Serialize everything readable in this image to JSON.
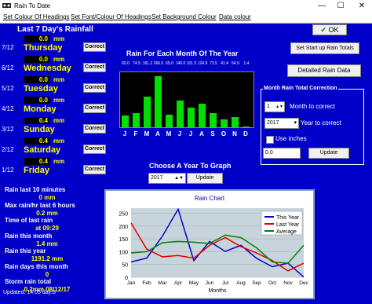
{
  "window": {
    "title": "Rain To Date",
    "min": "—",
    "max": "☐",
    "close": "✕"
  },
  "menu": [
    "Set Colour Of Headings",
    "Set Font/Colour Of Headings",
    "Set Background Colour",
    "Data colour"
  ],
  "ok_label": "OK",
  "heading_7day": "Last 7 Day's Rainfall",
  "days": [
    {
      "date": "7/12",
      "value": "0.0",
      "unit": "mm",
      "name": "Thursday",
      "btn": "Correct"
    },
    {
      "date": "6/12",
      "value": "0.0",
      "unit": "mm",
      "name": "Wednesday",
      "btn": "Correct"
    },
    {
      "date": "5/12",
      "value": "0.0",
      "unit": "mm",
      "name": "Tuesday",
      "btn": "Correct"
    },
    {
      "date": "4/12",
      "value": "0.0",
      "unit": "mm",
      "name": "Monday",
      "btn": "Correct"
    },
    {
      "date": "3/12",
      "value": "0.4",
      "unit": "mm",
      "name": "Sunday",
      "btn": "Correct"
    },
    {
      "date": "2/12",
      "value": "0.4",
      "unit": "mm",
      "name": "Saturday",
      "btn": "Correct"
    },
    {
      "date": "1/12",
      "value": "0.4",
      "unit": "mm",
      "name": "Friday",
      "btn": "Correct"
    }
  ],
  "stats": [
    {
      "label": "Rain last 10 minutes",
      "value": "0 mm"
    },
    {
      "label": "Max rain/hr last 6 hours",
      "value": "0.2 mm"
    },
    {
      "label": "Time of last rain",
      "value": "at 09:29"
    },
    {
      "label": "Rain this month",
      "value": "1.4 mm"
    },
    {
      "label": "Rain this year",
      "value": "1191.2 mm"
    },
    {
      "label": "Rain days this month",
      "value": "0"
    },
    {
      "label": "Storm rain total",
      "value": "0.2mm 08/12/17"
    }
  ],
  "updated": "Updated: 14:05 day:8",
  "monthly": {
    "title": "Rain For Each Month Of The Year",
    "months": [
      "J",
      "F",
      "M",
      "A",
      "M",
      "J",
      "J",
      "A",
      "S",
      "O",
      "N",
      "D"
    ],
    "values": [
      60.0,
      74.5,
      161.2,
      266.0,
      65.0,
      140.0,
      101.5,
      124.9,
      73.5,
      41.4,
      54.9,
      1.4
    ],
    "value_labels": [
      "60.0",
      "74.5",
      "161.2",
      "266.0",
      "65.0",
      "140.0",
      "101.5",
      "124.9",
      "73.5",
      "41.4",
      "54.9",
      "1.4"
    ],
    "max": 280
  },
  "choose_year": {
    "label": "Choose A Year To Graph",
    "value": "2017",
    "btn": "Update"
  },
  "right": {
    "startup_btn": "Set Start up Rain Totals",
    "detailed_btn": "Detailed Rain Data"
  },
  "correction": {
    "title": "Month Rain Total Correction",
    "month_value": "1",
    "month_label": "Month to correct",
    "year_value": "2017",
    "year_label": "Year to correct",
    "use_inches": "Use inches",
    "amount": "0.0",
    "btn": "Update"
  },
  "chart_data": {
    "type": "line",
    "title": "Rain Chart",
    "xlabel": "Months",
    "ylabel": "",
    "categories": [
      "Jan",
      "Feb",
      "Mar",
      "Apr",
      "May",
      "Jun",
      "Jul",
      "Aug",
      "Sep",
      "Oct",
      "Nov",
      "Dec"
    ],
    "yticks": [
      0,
      50,
      100,
      150,
      200,
      250
    ],
    "ylim": [
      0,
      270
    ],
    "series": [
      {
        "name": "This Year",
        "color": "#0000cc",
        "values": [
          60,
          75,
          161,
          266,
          65,
          140,
          101,
          125,
          74,
          41,
          55,
          1
        ]
      },
      {
        "name": "Last Year",
        "color": "#e00000",
        "values": [
          212,
          110,
          80,
          85,
          75,
          125,
          155,
          120,
          95,
          65,
          25,
          55
        ]
      },
      {
        "name": "Average",
        "color": "#008000",
        "values": [
          95,
          100,
          135,
          140,
          137,
          132,
          165,
          155,
          115,
          60,
          55,
          125
        ]
      }
    ]
  }
}
